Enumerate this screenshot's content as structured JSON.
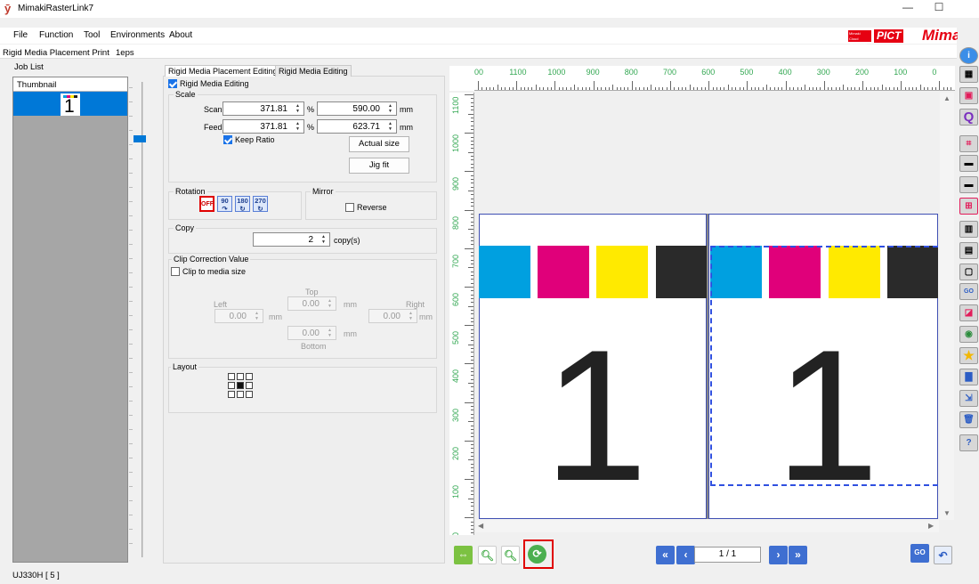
{
  "window": {
    "title": "MimakiRasterLink7",
    "app_icon": "mimaki-logo-icon",
    "minimize": "—",
    "maximize": "☐"
  },
  "menu": [
    "File",
    "Function",
    "Tool",
    "Environments",
    "About"
  ],
  "brand": {
    "cloud_text": "Mimaki Cloud Technology",
    "pict": "PICT",
    "mimaki": "Mimaki"
  },
  "top_tabs": {
    "function_name": "Rigid Media Placement Print",
    "job": "1eps"
  },
  "job_list": {
    "tab": "Job List",
    "header": "Thumbnail",
    "thumb_number": "1"
  },
  "panel": {
    "subtabs": [
      "Rigid Media Placement Editing",
      "Rigid Media Editing"
    ],
    "rigid_media_editing": "Rigid Media Editing",
    "scale": {
      "group": "Scale",
      "scan_label": "Scan",
      "scan_percent": "371.81",
      "scan_mm": "590.00",
      "feed_label": "Feed",
      "feed_percent": "371.81",
      "feed_mm": "623.71",
      "percent_unit": "%",
      "mm_unit": "mm",
      "keep_ratio": "Keep Ratio",
      "actual_size": "Actual size",
      "jig_fit": "Jig fit"
    },
    "rotation": {
      "group": "Rotation",
      "off": "OFF",
      "r90": "90",
      "r180": "180",
      "r270": "270"
    },
    "mirror": {
      "group": "Mirror",
      "reverse": "Reverse"
    },
    "copy": {
      "group": "Copy",
      "value": "2",
      "unit": "copy(s)"
    },
    "clip": {
      "group": "Clip Correction Value",
      "clip_to_media": "Clip to media size",
      "top_label": "Top",
      "top": "0.00",
      "left_label": "Left",
      "left": "0.00",
      "right_label": "Right",
      "right": "0.00",
      "bottom_label": "Bottom",
      "bottom": "0.00",
      "unit": "mm"
    },
    "layout": {
      "group": "Layout"
    }
  },
  "preview": {
    "ruler_h": [
      "00",
      "1100",
      "1000",
      "900",
      "800",
      "700",
      "600",
      "500",
      "400",
      "300",
      "200",
      "100",
      "0"
    ],
    "ruler_v": [
      "1100",
      "1000",
      "900",
      "800",
      "700",
      "600",
      "500",
      "400",
      "300",
      "200",
      "100",
      "0"
    ],
    "big_number": "1",
    "swatch_colors": [
      "#00a0e0",
      "#e0007a",
      "#ffea00",
      "#2a2a2a"
    ]
  },
  "toolbar": {
    "page": "1 / 1"
  },
  "status": "UJ330H [ 5 ]"
}
